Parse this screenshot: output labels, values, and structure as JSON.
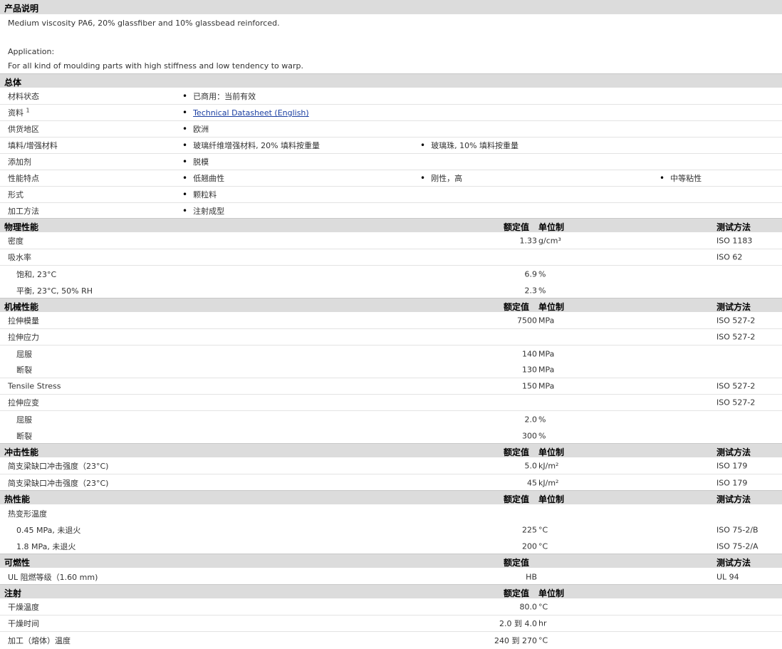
{
  "description": {
    "header": "产品说明",
    "line1": "Medium viscosity PA6, 20% glassfiber and 10% glassbead reinforced.",
    "app_label": "Application:",
    "app_text": "For all kind of moulding parts with high stiffness and low tendency to warp."
  },
  "general": {
    "header": "总体",
    "rows": [
      {
        "label": "材料状态",
        "b1": "已商用：当前有效"
      },
      {
        "label": "资料",
        "sup": "1",
        "link": "Technical Datasheet (English)"
      },
      {
        "label": "供货地区",
        "b1": "欧洲"
      },
      {
        "label": "填料/增强材料",
        "b1": "玻璃纤维增强材料, 20% 填料按重量",
        "b2": "玻璃珠, 10% 填料按重量"
      },
      {
        "label": "添加剂",
        "b1": "脱模"
      },
      {
        "label": "性能特点",
        "b1": "低翘曲性",
        "b2": "刚性，高",
        "b3": "中等粘性"
      },
      {
        "label": "形式",
        "b1": "颗粒料"
      },
      {
        "label": "加工方法",
        "b1": "注射成型"
      }
    ]
  },
  "cols": {
    "value": "额定值",
    "unit": "单位制",
    "method": "测试方法"
  },
  "physical": {
    "header": "物理性能",
    "rows": [
      {
        "label": "密度",
        "value": "1.33",
        "unit": "g/cm³",
        "method": "ISO 1183"
      },
      {
        "label": "吸水率",
        "method": "ISO 62"
      },
      {
        "label": "饱和, 23°C",
        "sub": true,
        "value": "6.9",
        "unit": "%"
      },
      {
        "label": "平衡, 23°C, 50% RH",
        "sub": true,
        "value": "2.3",
        "unit": "%"
      }
    ]
  },
  "mechanical": {
    "header": "机械性能",
    "rows": [
      {
        "label": "拉伸模量",
        "value": "7500",
        "unit": "MPa",
        "method": "ISO 527-2"
      },
      {
        "label": "拉伸应力",
        "method": "ISO 527-2"
      },
      {
        "label": "屈服",
        "sub": true,
        "value": "140",
        "unit": "MPa"
      },
      {
        "label": "断裂",
        "sub": true,
        "value": "130",
        "unit": "MPa"
      },
      {
        "label": "Tensile Stress",
        "value": "150",
        "unit": "MPa",
        "method": "ISO 527-2"
      },
      {
        "label": "拉伸应变",
        "method": "ISO 527-2"
      },
      {
        "label": "屈服",
        "sub": true,
        "value": "2.0",
        "unit": "%"
      },
      {
        "label": "断裂",
        "sub": true,
        "value": "300",
        "unit": "%"
      }
    ]
  },
  "impact": {
    "header": "冲击性能",
    "rows": [
      {
        "label": "简支梁缺口冲击强度（23°C)",
        "value": "5.0",
        "unit": "kJ/m²",
        "method": "ISO 179"
      },
      {
        "label": "简支梁缺口冲击强度（23°C)",
        "value": "45",
        "unit": "kJ/m²",
        "method": "ISO 179"
      }
    ]
  },
  "thermal": {
    "header": "热性能",
    "rows": [
      {
        "label": "热变形温度"
      },
      {
        "label": "0.45 MPa, 未退火",
        "sub": true,
        "value": "225",
        "unit": "°C",
        "method": "ISO 75-2/B"
      },
      {
        "label": "1.8 MPa, 未退火",
        "sub": true,
        "value": "200",
        "unit": "°C",
        "method": "ISO 75-2/A"
      }
    ]
  },
  "flammability": {
    "header": "可燃性",
    "rows": [
      {
        "label": "UL 阻燃等级（1.60 mm)",
        "value": "HB",
        "method": "UL 94"
      }
    ]
  },
  "injection": {
    "header": "注射",
    "rows": [
      {
        "label": "干燥温度",
        "value": "80.0",
        "unit": "°C"
      },
      {
        "label": "干燥时间",
        "value": "2.0 到  4.0",
        "unit": "hr"
      },
      {
        "label": "加工（熔体）温度",
        "value": "240 到  270",
        "unit": "°C"
      }
    ]
  }
}
